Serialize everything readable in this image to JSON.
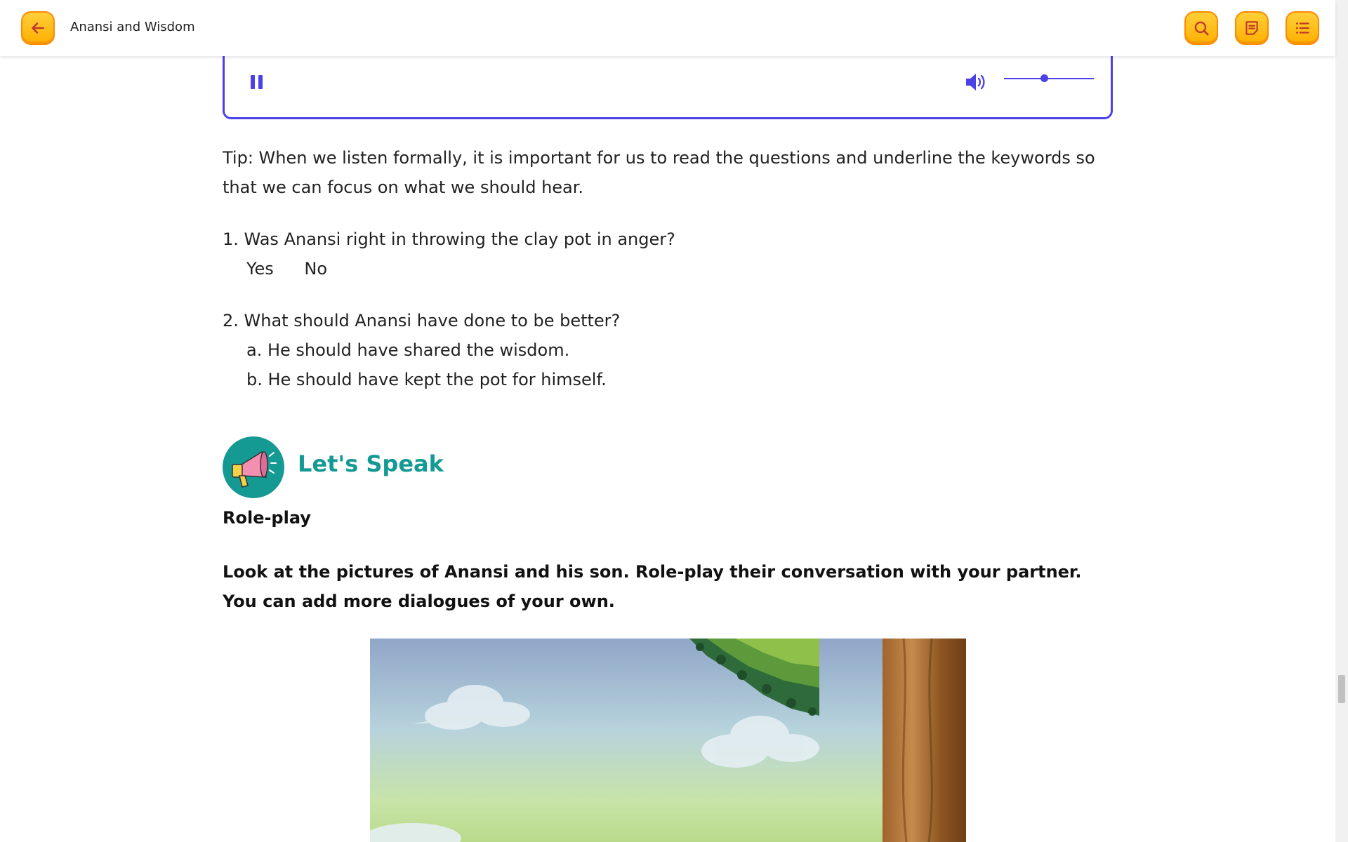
{
  "header": {
    "title": "Anansi and Wisdom"
  },
  "audio": {
    "volume": 0.4
  },
  "tip": "Tip: When we listen formally, it is important for us to read the questions and underline the keywords so that we can focus on what we should hear.",
  "questions": [
    {
      "text": "1. Was Anansi right in throwing the clay pot in anger?",
      "options": [
        "Yes",
        "No"
      ]
    },
    {
      "text": "2. What should Anansi have done to be better?",
      "options": [
        "a. He should have shared the wisdom.",
        "b. He should have kept the pot for himself."
      ]
    }
  ],
  "speak": {
    "title": "Let's Speak",
    "subheading": "Role-play",
    "instruction": "Look at the pictures of Anansi and his son. Role-play their conversation with your partner. You can add more dialogues of your own."
  },
  "colors": {
    "accent_orange": "#ffb000",
    "audio_border": "#4a41e6",
    "speak_teal": "#149a93"
  },
  "icons": [
    "back-arrow-icon",
    "search-icon",
    "notes-icon",
    "list-icon",
    "pause-icon",
    "volume-icon",
    "megaphone-icon"
  ]
}
